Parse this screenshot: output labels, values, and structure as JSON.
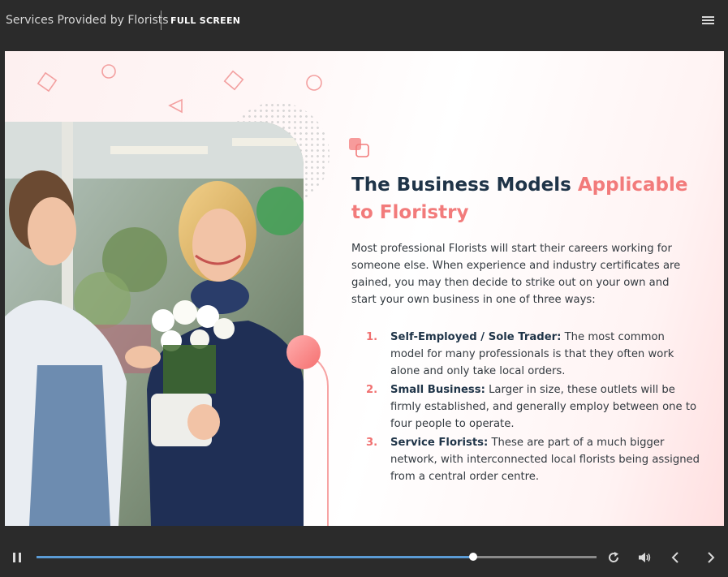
{
  "header": {
    "course_title": "Services Provided by Florists",
    "fullscreen_label": "FULL SCREEN",
    "menu_icon": "hamburger-menu-icon"
  },
  "slide": {
    "heading_main": "The Business Models",
    "heading_accent": "Applicable to Floristry",
    "intro": "Most professional Florists will start their careers working for someone else. When experience and industry certificates are gained, you may then decide to strike out on your own and start your own business in one of three ways:",
    "items": [
      {
        "number": "1.",
        "title": "Self-Employed / Sole Trader:",
        "text": " The most common model for many professionals is that they often work alone and only take local orders."
      },
      {
        "number": "2.",
        "title": "Small Business:",
        "text": " Larger in size, these outlets will be firmly established, and generally employ between one to four people to operate."
      },
      {
        "number": "3.",
        "title": "Service Florists:",
        "text": " These are part of a much bigger network, with interconnected local florists being assigned from a central order centre."
      }
    ],
    "colors": {
      "accent": "#f27b7b",
      "heading": "#1f3448",
      "number": "#f07070"
    }
  },
  "player": {
    "progress": 0.78,
    "progress_color": "#5b9bd5",
    "icons": [
      "pause-icon",
      "replay-icon",
      "volume-icon",
      "prev-icon",
      "next-icon"
    ]
  }
}
